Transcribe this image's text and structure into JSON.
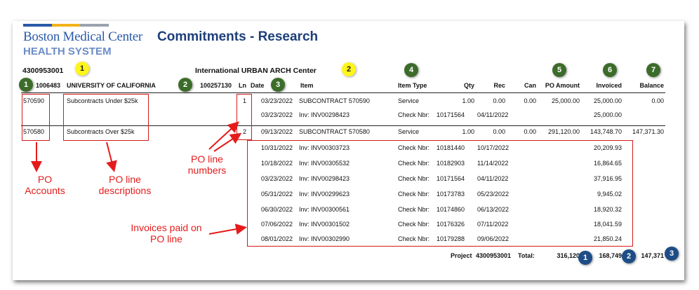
{
  "header": {
    "logo_line1": "Boston Medical Center",
    "logo_line2": "HEALTH SYSTEM",
    "title": "Commitments - Research"
  },
  "project": {
    "number": "4300953001",
    "center": "International URBAN ARCH Center",
    "vendor_id": "1006483",
    "vendor_name": "UNIVERSITY OF CALIFORNIA",
    "account_id": "100257130"
  },
  "columns": {
    "ln": "Ln",
    "date": "Date",
    "item": "Item",
    "item_type": "Item Type",
    "qty": "Qty",
    "rec": "Rec",
    "can": "Can",
    "po_amount": "PO Amount",
    "invoiced": "Invoiced",
    "balance": "Balance"
  },
  "po_lines": [
    {
      "account": "570590",
      "description": "Subcontracts Under $25k",
      "ln": "1",
      "date": "03/23/2022",
      "item": "SUBCONTRACT 570590",
      "item_type": "Service",
      "qty": "1.00",
      "rec": "0.00",
      "can": "0.00",
      "po_amount": "25,000.00",
      "invoiced": "25,000.00",
      "balance": "0.00",
      "invoices": [
        {
          "date": "03/23/2022",
          "inv": "Inv: INV00298423",
          "check_label": "Check Nbr:",
          "check": "10171564",
          "check_date": "04/11/2022",
          "amount": "25,000.00"
        }
      ]
    },
    {
      "account": "570580",
      "description": "Subcontracts Over $25k",
      "ln": "2",
      "date": "09/13/2022",
      "item": "SUBCONTRACT 570580",
      "item_type": "Service",
      "qty": "1.00",
      "rec": "0.00",
      "can": "0.00",
      "po_amount": "291,120.00",
      "invoiced": "143,748.70",
      "balance": "147,371.30",
      "invoices": [
        {
          "date": "10/31/2022",
          "inv": "Inv: INV00303723",
          "check_label": "Check Nbr:",
          "check": "10181440",
          "check_date": "10/17/2022",
          "amount": "20,209.93"
        },
        {
          "date": "10/18/2022",
          "inv": "Inv: INV00305532",
          "check_label": "Check Nbr:",
          "check": "10182903",
          "check_date": "11/14/2022",
          "amount": "16,864.65"
        },
        {
          "date": "03/23/2022",
          "inv": "Inv: INV00298423",
          "check_label": "Check Nbr:",
          "check": "10171564",
          "check_date": "04/11/2022",
          "amount": "37,916.95"
        },
        {
          "date": "05/31/2022",
          "inv": "Inv: INV00299623",
          "check_label": "Check Nbr:",
          "check": "10173783",
          "check_date": "05/23/2022",
          "amount": "9,945.02"
        },
        {
          "date": "06/30/2022",
          "inv": "Inv: INV00300561",
          "check_label": "Check Nbr:",
          "check": "10174860",
          "check_date": "06/13/2022",
          "amount": "18,920.32"
        },
        {
          "date": "07/06/2022",
          "inv": "Inv: INV00301502",
          "check_label": "Check Nbr:",
          "check": "10176326",
          "check_date": "07/11/2022",
          "amount": "18,041.59"
        },
        {
          "date": "08/01/2022",
          "inv": "Inv: INV00302990",
          "check_label": "Check Nbr:",
          "check": "10179288",
          "check_date": "09/06/2022",
          "amount": "21,850.24"
        }
      ]
    }
  ],
  "total": {
    "label": "Project",
    "project": "4300953001",
    "total_label": "Total:",
    "po_amount": "316,120",
    "invoiced": "168,749",
    "balance": "147,371"
  },
  "badges": {
    "yellow": [
      "1",
      "2"
    ],
    "green": [
      "1",
      "2",
      "3",
      "4",
      "5",
      "6",
      "7"
    ],
    "blue": [
      "1",
      "2",
      "3"
    ]
  },
  "callouts": {
    "po_accounts": "PO\nAccounts",
    "po_line_desc": "PO line\ndescriptions",
    "po_line_numbers": "PO line\nnumbers",
    "invoices_paid": "Invoices paid on\nPO line"
  },
  "colors": {
    "callout_red": "#e51b1b",
    "badge_green": "#3c6c2a",
    "badge_yellow": "#fef51a",
    "badge_blue": "#1e4c86",
    "title_blue": "#1d3f7a"
  }
}
